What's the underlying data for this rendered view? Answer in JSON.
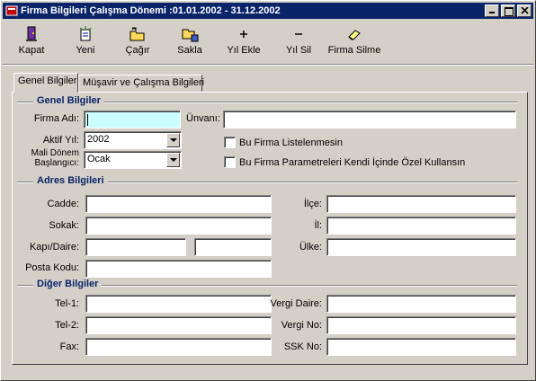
{
  "window": {
    "title": "Firma Bilgileri Çalışma Dönemi :01.01.2002 - 31.12.2002"
  },
  "toolbar": {
    "kapat": "Kapat",
    "yeni": "Yeni",
    "cagir": "Çağır",
    "sakla": "Sakla",
    "yil_ekle": "Yıl Ekle",
    "yil_sil": "Yıl Sil",
    "firma_silme": "Firma Silme"
  },
  "tabs": [
    "Genel Bilgiler",
    "Müşavir ve Çalışma Bilgileri"
  ],
  "genel": {
    "title": "Genel Bilgiler",
    "firma_adi_label": "Firma Adı:",
    "firma_adi_value": "",
    "unvan_label": "Ünvanı:",
    "unvan_value": "",
    "aktif_yil_label": "Aktif Yıl:",
    "aktif_yil_value": "2002",
    "mali_donem_label_1": "Mali Dönem",
    "mali_donem_label_2": "Başlangıcı:",
    "mali_donem_value": "Ocak",
    "chk_listelenmesin": "Bu Firma Listelenmesin",
    "chk_parametreleri": "Bu Firma Parametreleri Kendi İçinde Özel Kullansın"
  },
  "adres": {
    "title": "Adres Bilgileri",
    "cadde_label": "Cadde:",
    "sokak_label": "Sokak:",
    "kapi_label": "Kapı/Daire:",
    "posta_label": "Posta Kodu:",
    "ilce_label": "İlçe:",
    "il_label": "İl:",
    "ulke_label": "Ülke:"
  },
  "diger": {
    "title": "Diğer Bilgiler",
    "tel1_label": "Tel-1:",
    "tel2_label": "Tel-2:",
    "fax_label": "Fax:",
    "vergi_daire_label": "Vergi Daire:",
    "vergi_no_label": "Vergi No:",
    "ssk_label": "SSK No:"
  }
}
